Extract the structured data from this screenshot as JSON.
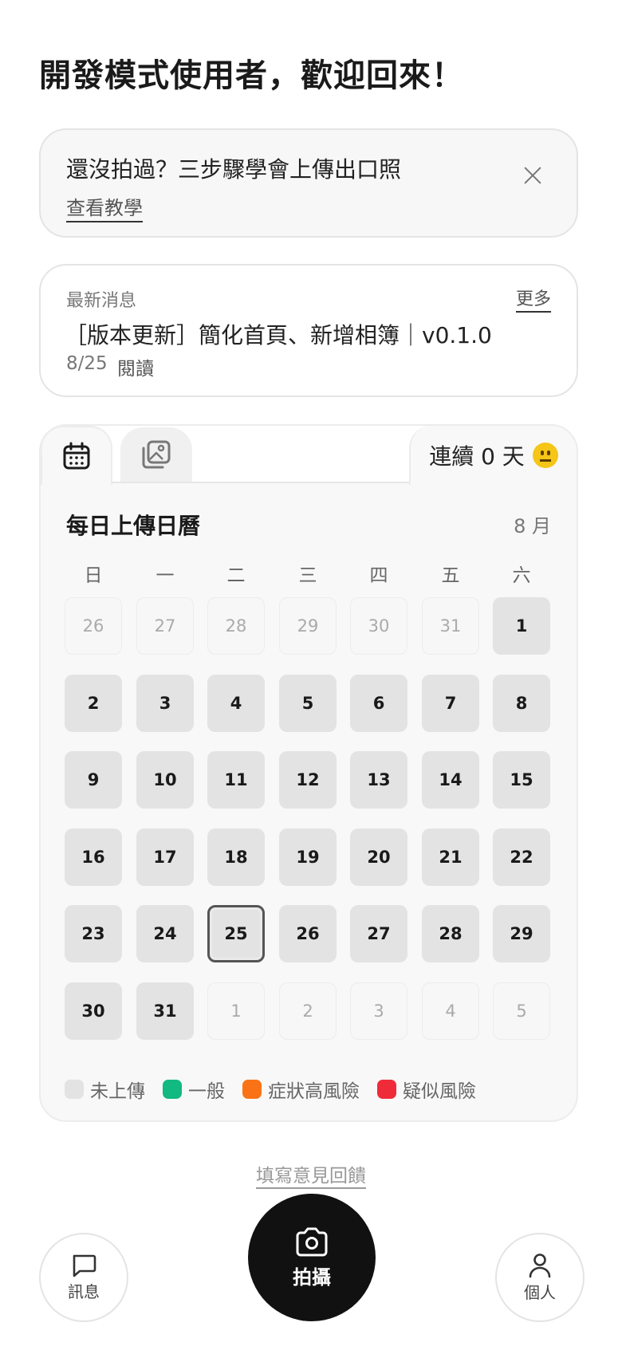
{
  "greeting": "開發模式使用者，歡迎回來！",
  "tutorial": {
    "title": "還沒拍過？三步驟學會上傳出口照",
    "link": "查看教學",
    "close_icon": "close-icon"
  },
  "news": {
    "label": "最新消息",
    "more": "更多",
    "title": "［版本更新］簡化首頁、新增相簿｜v0.1.0",
    "date": "8/25",
    "read": "閱讀"
  },
  "calendar": {
    "tabs": [
      {
        "icon": "calendar-icon"
      },
      {
        "icon": "gallery-icon"
      }
    ],
    "streak": "連續 0 天",
    "streak_emoji": "neutral-face-emoji",
    "title": "每日上傳日曆",
    "month": "8 月",
    "weekdays": [
      "日",
      "一",
      "二",
      "三",
      "四",
      "五",
      "六"
    ],
    "weeks": [
      [
        {
          "d": "26",
          "cur": false
        },
        {
          "d": "27",
          "cur": false
        },
        {
          "d": "28",
          "cur": false
        },
        {
          "d": "29",
          "cur": false
        },
        {
          "d": "30",
          "cur": false
        },
        {
          "d": "31",
          "cur": false
        },
        {
          "d": "1",
          "cur": true
        }
      ],
      [
        {
          "d": "2",
          "cur": true
        },
        {
          "d": "3",
          "cur": true
        },
        {
          "d": "4",
          "cur": true
        },
        {
          "d": "5",
          "cur": true
        },
        {
          "d": "6",
          "cur": true
        },
        {
          "d": "7",
          "cur": true
        },
        {
          "d": "8",
          "cur": true
        }
      ],
      [
        {
          "d": "9",
          "cur": true
        },
        {
          "d": "10",
          "cur": true
        },
        {
          "d": "11",
          "cur": true
        },
        {
          "d": "12",
          "cur": true
        },
        {
          "d": "13",
          "cur": true
        },
        {
          "d": "14",
          "cur": true
        },
        {
          "d": "15",
          "cur": true
        }
      ],
      [
        {
          "d": "16",
          "cur": true
        },
        {
          "d": "17",
          "cur": true
        },
        {
          "d": "18",
          "cur": true
        },
        {
          "d": "19",
          "cur": true
        },
        {
          "d": "20",
          "cur": true
        },
        {
          "d": "21",
          "cur": true
        },
        {
          "d": "22",
          "cur": true
        }
      ],
      [
        {
          "d": "23",
          "cur": true
        },
        {
          "d": "24",
          "cur": true
        },
        {
          "d": "25",
          "cur": true,
          "today": true
        },
        {
          "d": "26",
          "cur": true
        },
        {
          "d": "27",
          "cur": true
        },
        {
          "d": "28",
          "cur": true
        },
        {
          "d": "29",
          "cur": true
        }
      ],
      [
        {
          "d": "30",
          "cur": true
        },
        {
          "d": "31",
          "cur": true
        },
        {
          "d": "1",
          "cur": false
        },
        {
          "d": "2",
          "cur": false
        },
        {
          "d": "3",
          "cur": false
        },
        {
          "d": "4",
          "cur": false
        },
        {
          "d": "5",
          "cur": false
        }
      ]
    ],
    "legend": [
      {
        "label": "未上傳",
        "color": "#e3e3e3"
      },
      {
        "label": "一般",
        "color": "#12b981"
      },
      {
        "label": "症狀高風險",
        "color": "#f97316"
      },
      {
        "label": "疑似風險",
        "color": "#ef2b3a"
      }
    ]
  },
  "feedback": "填寫意見回饋",
  "nav": {
    "messages": "訊息",
    "camera": "拍攝",
    "profile": "個人"
  }
}
